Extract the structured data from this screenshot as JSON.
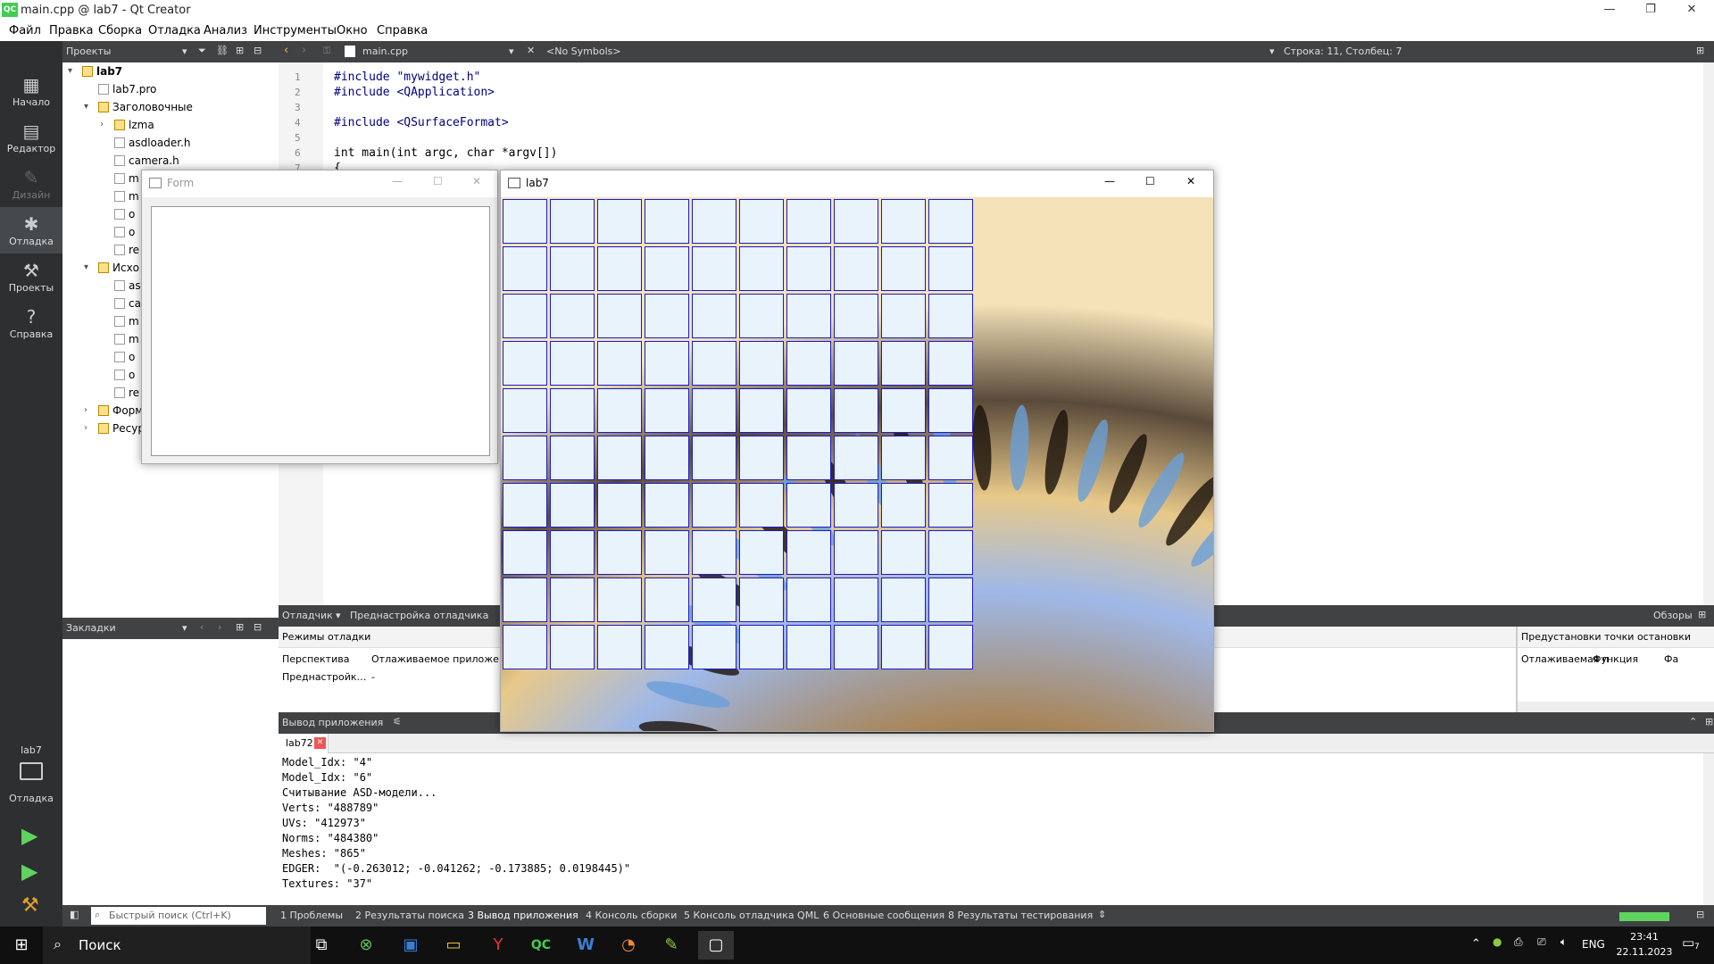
{
  "window": {
    "title": "main.cpp @ lab7 - Qt Creator",
    "logo": "QC"
  },
  "menu": [
    "Файл",
    "Правка",
    "Сборка",
    "Отладка",
    "Анализ",
    "Инструменты",
    "Окно",
    "Справка"
  ],
  "modes": [
    {
      "label": "Начало",
      "icon": "grid-icon"
    },
    {
      "label": "Редактор",
      "icon": "editor-icon"
    },
    {
      "label": "Дизайн",
      "icon": "pen-icon"
    },
    {
      "label": "Отладка",
      "icon": "bug-icon"
    },
    {
      "label": "Проекты",
      "icon": "wrench-icon"
    },
    {
      "label": "Справка",
      "icon": "help-icon"
    }
  ],
  "target": {
    "project": "lab7",
    "mode": "Отладка"
  },
  "projects_panel": {
    "header": "Проекты",
    "tree": [
      {
        "label": "lab7",
        "level": 0,
        "expanded": true,
        "kind": "project"
      },
      {
        "label": "lab7.pro",
        "level": 1,
        "kind": "file"
      },
      {
        "label": "Заголовочные",
        "level": 1,
        "expanded": true,
        "kind": "folder"
      },
      {
        "label": "lzma",
        "level": 2,
        "expanded": false,
        "kind": "folder"
      },
      {
        "label": "asdloader.h",
        "level": 2,
        "kind": "file"
      },
      {
        "label": "camera.h",
        "level": 2,
        "kind": "file"
      },
      {
        "label": "m",
        "level": 2,
        "kind": "file"
      },
      {
        "label": "m",
        "level": 2,
        "kind": "file"
      },
      {
        "label": "o",
        "level": 2,
        "kind": "file"
      },
      {
        "label": "o",
        "level": 2,
        "kind": "file"
      },
      {
        "label": "re",
        "level": 2,
        "kind": "file"
      },
      {
        "label": "Исхо",
        "level": 1,
        "expanded": true,
        "kind": "folder"
      },
      {
        "label": "as",
        "level": 2,
        "kind": "file"
      },
      {
        "label": "ca",
        "level": 2,
        "kind": "file"
      },
      {
        "label": "m",
        "level": 2,
        "kind": "file"
      },
      {
        "label": "m",
        "level": 2,
        "kind": "file"
      },
      {
        "label": "o",
        "level": 2,
        "kind": "file"
      },
      {
        "label": "o",
        "level": 2,
        "kind": "file"
      },
      {
        "label": "re",
        "level": 2,
        "kind": "file"
      },
      {
        "label": "Форм",
        "level": 1,
        "expanded": false,
        "kind": "folder"
      },
      {
        "label": "Ресур",
        "level": 1,
        "expanded": false,
        "kind": "folder"
      }
    ]
  },
  "bookmarks": {
    "header": "Закладки"
  },
  "editor": {
    "file": "main.cpp",
    "symbols": "<No Symbols>",
    "position": "Строка: 11, Столбец: 7",
    "lines": [
      {
        "n": "1",
        "text": "#include \"mywidget.h\""
      },
      {
        "n": "2",
        "text": "#include <QApplication>"
      },
      {
        "n": "3",
        "text": ""
      },
      {
        "n": "4",
        "text": "#include <QSurfaceFormat>"
      },
      {
        "n": "5",
        "text": ""
      },
      {
        "n": "6",
        "text": "int main(int argc, char *argv[])"
      },
      {
        "n": "7",
        "text": "{"
      }
    ]
  },
  "debugger": {
    "left": "Отладчик",
    "preset": "Преднастройка отладчика",
    "overview": "Обзоры",
    "modes_title": "Режимы отладки",
    "col1": "Перспектива",
    "col2": "Отлаживаемое приложен",
    "row_label": "Преднастройк…",
    "row_value": "-",
    "bp_title": "Предустановки точки остановки",
    "bp_col1": "Отлаживаемая п",
    "bp_col2": "Функция",
    "bp_col3": "Фа"
  },
  "output": {
    "header": "Вывод приложения",
    "tab": "lab72",
    "lines": [
      "Model_Idx: \"4\"",
      "Model_Idx: \"6\"",
      "Считывание ASD-модели...",
      "Verts: \"488789\"",
      "UVs: \"412973\"",
      "Norms: \"484380\"",
      "Meshes: \"865\"",
      "EDGER:  \"(-0.263012; -0.041262; -0.173885; 0.0198445)\"",
      "Textures: \"37\""
    ]
  },
  "statusbar": {
    "search_placeholder": "Быстрый поиск (Ctrl+K)",
    "tabs": [
      "1 Проблемы",
      "2 Результаты поиска",
      "3 Вывод приложения",
      "4 Консоль сборки",
      "5 Консоль отладчика QML",
      "6 Основные сообщения",
      "8 Результаты тестирования"
    ]
  },
  "form_window": {
    "title": "Form"
  },
  "lab7_window": {
    "title": "lab7",
    "grid_rows": 10,
    "grid_cols": 10
  },
  "taskbar": {
    "search": "Поиск",
    "lang": "ENG",
    "time": "23:41",
    "date": "22.11.2023",
    "notif": "7"
  },
  "colors": {
    "dark_panel": "#404244",
    "mode_bar": "#2e2f30",
    "tile": "#e8f3fc",
    "tile_border": "#1a1acc"
  }
}
